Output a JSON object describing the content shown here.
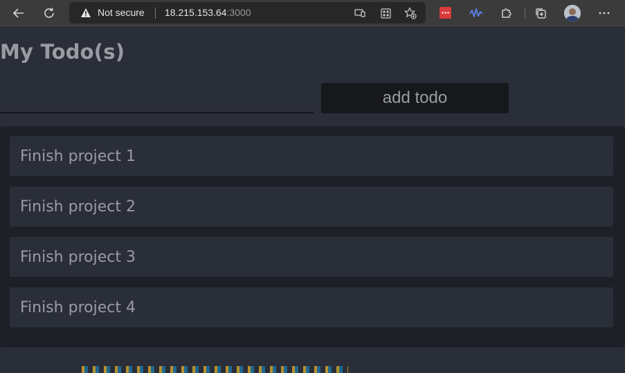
{
  "browser": {
    "security_label": "Not secure",
    "url_host": "18.215.153.64",
    "url_port": ":3000"
  },
  "page": {
    "title": "My Todo(s)",
    "input_value": "",
    "add_button_label": "add todo"
  },
  "todos": [
    {
      "text": "Finish project 1"
    },
    {
      "text": "Finish project 2"
    },
    {
      "text": "Finish project 3"
    },
    {
      "text": "Finish project 4"
    }
  ],
  "icons": [
    "back-arrow-icon",
    "refresh-icon",
    "warning-icon",
    "app-available-icon",
    "grid-icon",
    "add-favorite-icon",
    "extension-red-icon",
    "extension-wave-icon",
    "extensions-puzzle-icon",
    "collections-icon",
    "profile-avatar",
    "more-icon"
  ],
  "colors": {
    "page_background": "#2a2e38",
    "list_background": "#1d2026",
    "button_background": "#17181b",
    "text_muted": "#9a9ca3"
  }
}
